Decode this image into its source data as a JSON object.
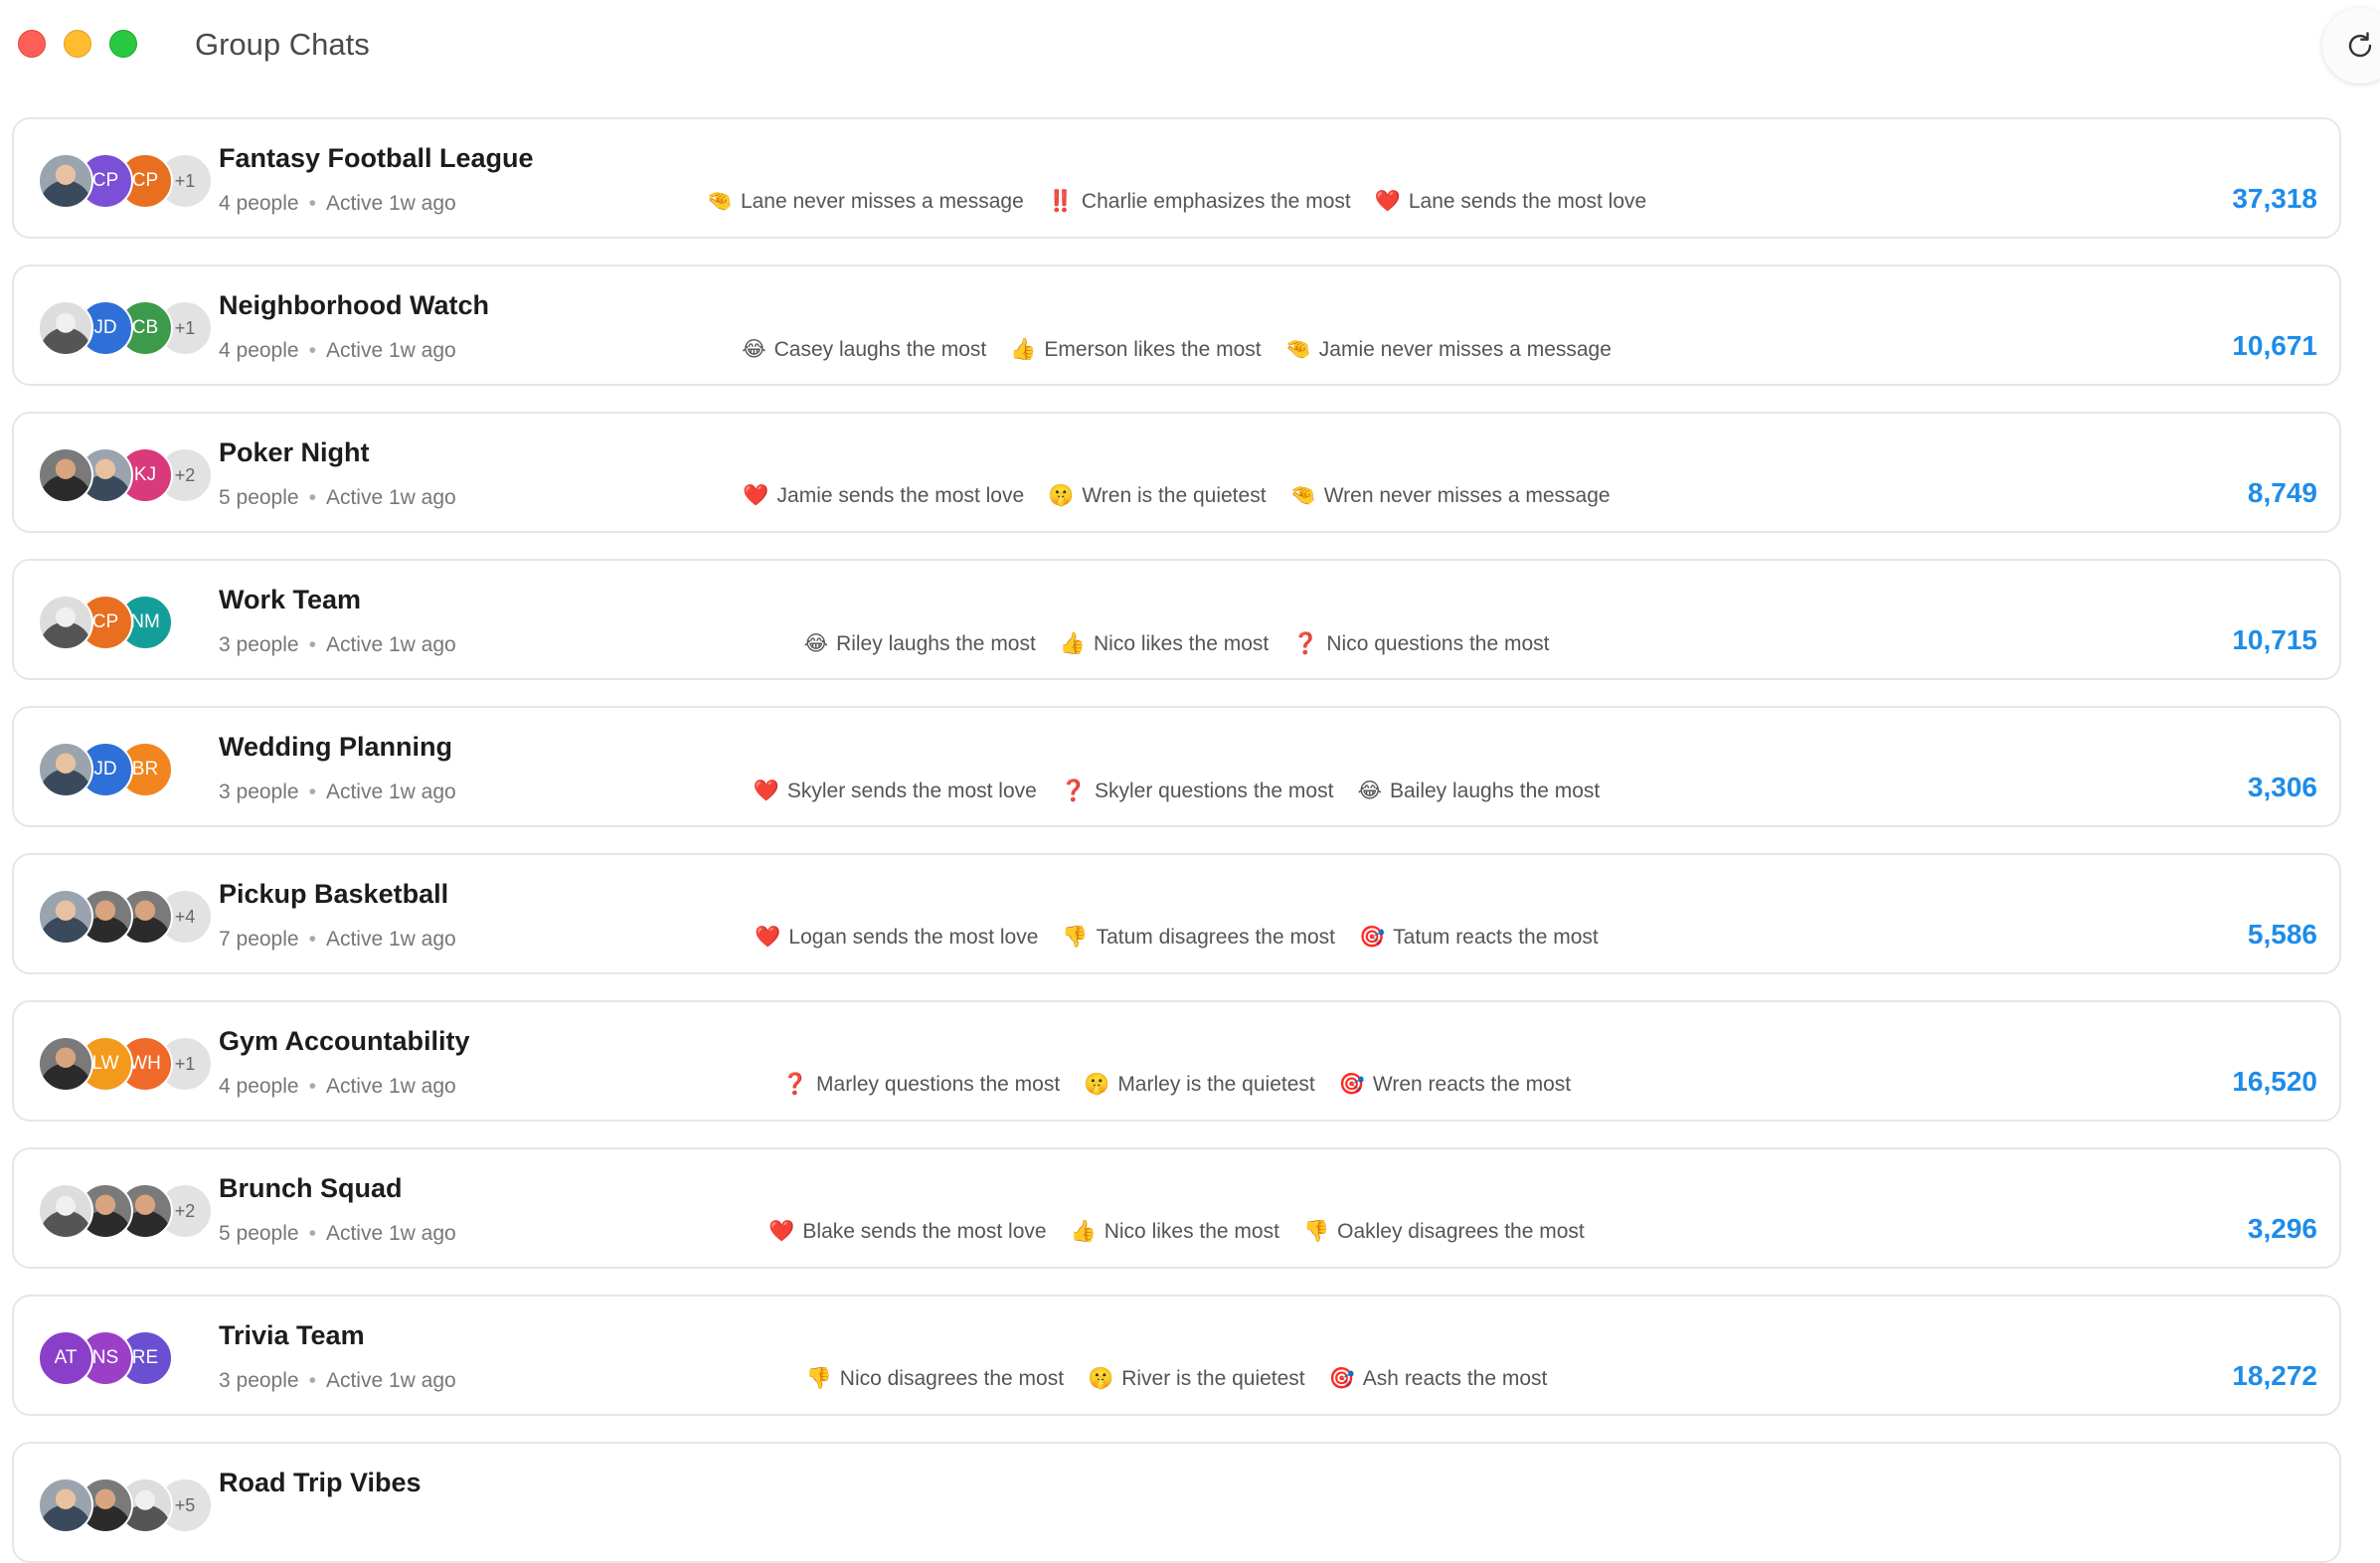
{
  "window": {
    "title": "Group Chats"
  },
  "refresh": {
    "icon": "refresh-icon"
  },
  "colors": {
    "accent": "#1e8ce8",
    "traffic_red": "#fe5f57",
    "traffic_yellow": "#febc2e",
    "traffic_green": "#28c840"
  },
  "chats": [
    {
      "name": "Fantasy Football League",
      "people": "4 people",
      "active": "Active 1w ago",
      "count": "37,318",
      "avatars": [
        {
          "kind": "photo",
          "initials": "",
          "color": ""
        },
        {
          "kind": "initials",
          "initials": "CP",
          "color": "#7b4fd6"
        },
        {
          "kind": "initials",
          "initials": "CP",
          "color": "#e86f1f"
        },
        {
          "kind": "more",
          "initials": "+1",
          "color": ""
        }
      ],
      "stats": [
        {
          "emoji": "🤏",
          "text": "Lane never misses a message"
        },
        {
          "emoji": "‼️",
          "text": "Charlie emphasizes the most"
        },
        {
          "emoji": "❤️",
          "text": "Lane sends the most love"
        }
      ]
    },
    {
      "name": "Neighborhood Watch",
      "people": "4 people",
      "active": "Active 1w ago",
      "count": "10,671",
      "avatars": [
        {
          "kind": "photo3",
          "initials": "",
          "color": ""
        },
        {
          "kind": "initials",
          "initials": "JD",
          "color": "#2f6fd8"
        },
        {
          "kind": "initials",
          "initials": "CB",
          "color": "#3c9a4a"
        },
        {
          "kind": "more",
          "initials": "+1",
          "color": ""
        }
      ],
      "stats": [
        {
          "emoji": "😂",
          "text": "Casey laughs the most"
        },
        {
          "emoji": "👍",
          "text": "Emerson likes the most"
        },
        {
          "emoji": "🤏",
          "text": "Jamie never misses a message"
        }
      ]
    },
    {
      "name": "Poker Night",
      "people": "5 people",
      "active": "Active 1w ago",
      "count": "8,749",
      "avatars": [
        {
          "kind": "photo2",
          "initials": "",
          "color": ""
        },
        {
          "kind": "photo",
          "initials": "",
          "color": ""
        },
        {
          "kind": "initials",
          "initials": "KJ",
          "color": "#d83a7c"
        },
        {
          "kind": "more",
          "initials": "+2",
          "color": ""
        }
      ],
      "stats": [
        {
          "emoji": "❤️",
          "text": "Jamie sends the most love"
        },
        {
          "emoji": "🤫",
          "text": "Wren is the quietest"
        },
        {
          "emoji": "🤏",
          "text": "Wren never misses a message"
        }
      ]
    },
    {
      "name": "Work Team",
      "people": "3 people",
      "active": "Active 1w ago",
      "count": "10,715",
      "avatars": [
        {
          "kind": "photo3",
          "initials": "",
          "color": ""
        },
        {
          "kind": "initials",
          "initials": "CP",
          "color": "#e86f1f"
        },
        {
          "kind": "initials",
          "initials": "NM",
          "color": "#149e9a"
        }
      ],
      "stats": [
        {
          "emoji": "😂",
          "text": "Riley laughs the most"
        },
        {
          "emoji": "👍",
          "text": "Nico likes the most"
        },
        {
          "emoji": "❓",
          "text": "Nico questions the most"
        }
      ]
    },
    {
      "name": "Wedding Planning",
      "people": "3 people",
      "active": "Active 1w ago",
      "count": "3,306",
      "avatars": [
        {
          "kind": "photo",
          "initials": "",
          "color": ""
        },
        {
          "kind": "initials",
          "initials": "JD",
          "color": "#2f6fd8"
        },
        {
          "kind": "initials",
          "initials": "BR",
          "color": "#f2851f"
        }
      ],
      "stats": [
        {
          "emoji": "❤️",
          "text": "Skyler sends the most love"
        },
        {
          "emoji": "❓",
          "text": "Skyler questions the most"
        },
        {
          "emoji": "😂",
          "text": "Bailey laughs the most"
        }
      ]
    },
    {
      "name": "Pickup Basketball",
      "people": "7 people",
      "active": "Active 1w ago",
      "count": "5,586",
      "avatars": [
        {
          "kind": "photo",
          "initials": "",
          "color": ""
        },
        {
          "kind": "photo2",
          "initials": "",
          "color": ""
        },
        {
          "kind": "photo2",
          "initials": "",
          "color": ""
        },
        {
          "kind": "more",
          "initials": "+4",
          "color": ""
        }
      ],
      "stats": [
        {
          "emoji": "❤️",
          "text": "Logan sends the most love"
        },
        {
          "emoji": "👎",
          "text": "Tatum disagrees the most"
        },
        {
          "emoji": "🎯",
          "text": "Tatum reacts the most"
        }
      ]
    },
    {
      "name": "Gym Accountability",
      "people": "4 people",
      "active": "Active 1w ago",
      "count": "16,520",
      "avatars": [
        {
          "kind": "photo2",
          "initials": "",
          "color": ""
        },
        {
          "kind": "initials",
          "initials": "LW",
          "color": "#f39a1c"
        },
        {
          "kind": "initials",
          "initials": "WH",
          "color": "#ef6a2a"
        },
        {
          "kind": "more",
          "initials": "+1",
          "color": ""
        }
      ],
      "stats": [
        {
          "emoji": "❓",
          "text": "Marley questions the most"
        },
        {
          "emoji": "🤫",
          "text": "Marley is the quietest"
        },
        {
          "emoji": "🎯",
          "text": "Wren reacts the most"
        }
      ]
    },
    {
      "name": "Brunch Squad",
      "people": "5 people",
      "active": "Active 1w ago",
      "count": "3,296",
      "avatars": [
        {
          "kind": "photo3",
          "initials": "",
          "color": ""
        },
        {
          "kind": "photo2",
          "initials": "",
          "color": ""
        },
        {
          "kind": "photo2",
          "initials": "",
          "color": ""
        },
        {
          "kind": "more",
          "initials": "+2",
          "color": ""
        }
      ],
      "stats": [
        {
          "emoji": "❤️",
          "text": "Blake sends the most love"
        },
        {
          "emoji": "👍",
          "text": "Nico likes the most"
        },
        {
          "emoji": "👎",
          "text": "Oakley disagrees the most"
        }
      ]
    },
    {
      "name": "Trivia Team",
      "people": "3 people",
      "active": "Active 1w ago",
      "count": "18,272",
      "avatars": [
        {
          "kind": "initials",
          "initials": "AT",
          "color": "#8a3fc9"
        },
        {
          "kind": "initials",
          "initials": "NS",
          "color": "#9b3fc9"
        },
        {
          "kind": "initials",
          "initials": "RE",
          "color": "#6a4fd0"
        }
      ],
      "stats": [
        {
          "emoji": "👎",
          "text": "Nico disagrees the most"
        },
        {
          "emoji": "🤫",
          "text": "River is the quietest"
        },
        {
          "emoji": "🎯",
          "text": "Ash reacts the most"
        }
      ]
    },
    {
      "name": "Road Trip Vibes",
      "people": "",
      "active": "",
      "count": "",
      "avatars": [
        {
          "kind": "photo",
          "initials": "",
          "color": ""
        },
        {
          "kind": "photo2",
          "initials": "",
          "color": ""
        },
        {
          "kind": "photo3",
          "initials": "",
          "color": ""
        },
        {
          "kind": "more",
          "initials": "+5",
          "color": ""
        }
      ],
      "stats": []
    }
  ]
}
